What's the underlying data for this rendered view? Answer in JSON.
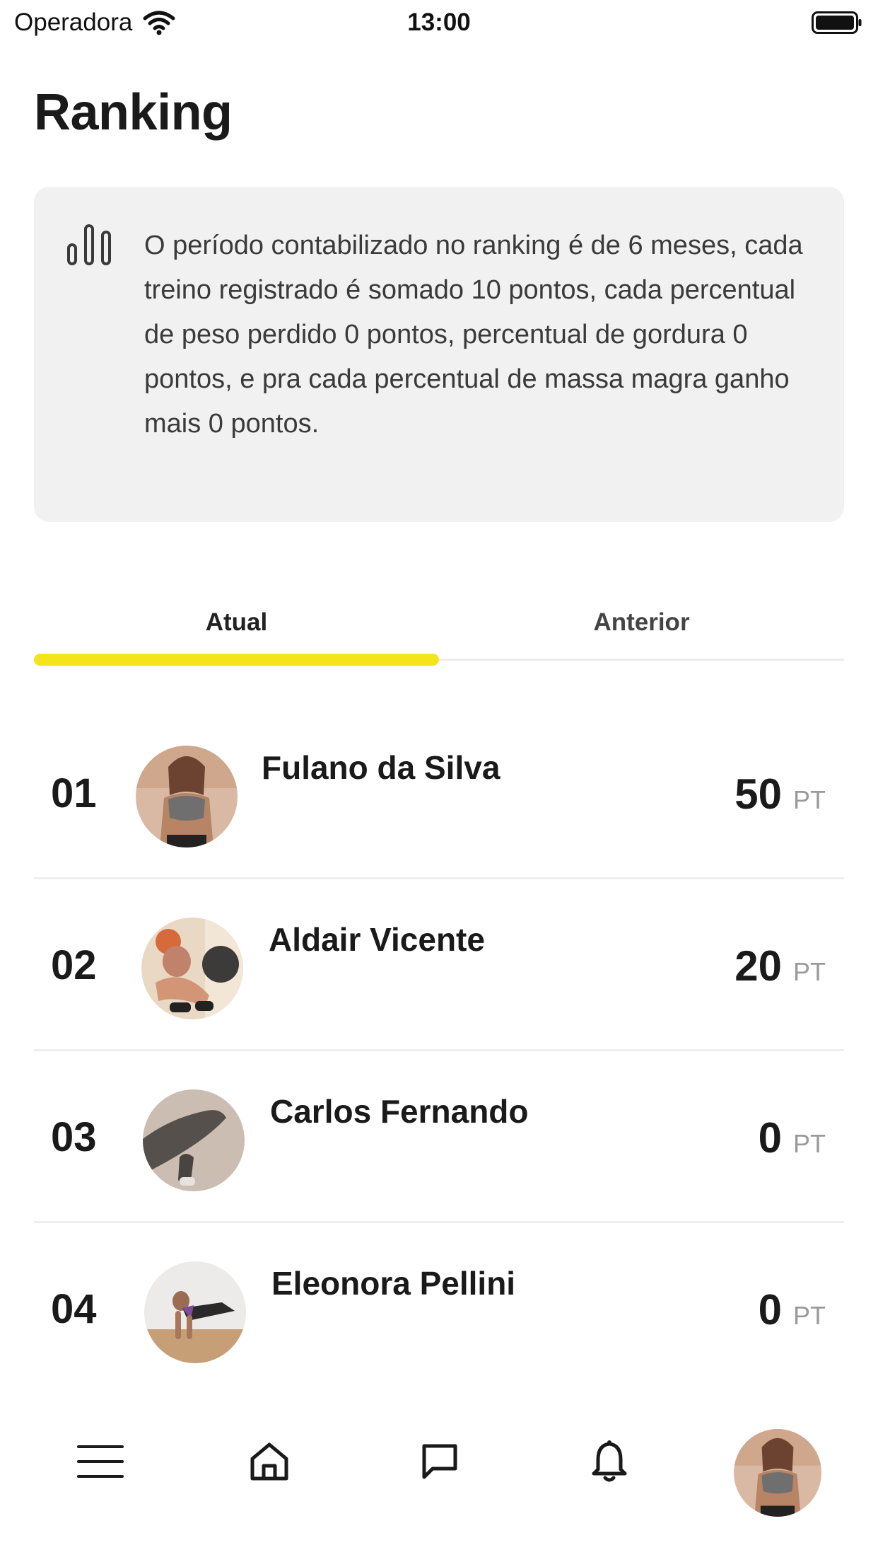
{
  "status_bar": {
    "carrier": "Operadora",
    "time": "13:00"
  },
  "page": {
    "title": "Ranking"
  },
  "info_card": {
    "icon": "bar-chart-icon",
    "text": "O período contabilizado no ranking é de 6 meses, cada treino registrado é somado 10 pontos, cada percentual de peso perdido 0 pontos, percentual de gordura 0 pontos, e pra cada percentual de massa magra ganho mais 0 pontos."
  },
  "tabs": [
    {
      "label": "Atual",
      "active": true
    },
    {
      "label": "Anterior",
      "active": false
    }
  ],
  "ranking": [
    {
      "position": "01",
      "name": "Fulano da Silva",
      "score": "50",
      "unit": "PT"
    },
    {
      "position": "02",
      "name": "Aldair Vicente",
      "score": "20",
      "unit": "PT"
    },
    {
      "position": "03",
      "name": "Carlos Fernando",
      "score": "0",
      "unit": "PT"
    },
    {
      "position": "04",
      "name": "Eleonora Pellini",
      "score": "0",
      "unit": "PT"
    }
  ],
  "bottom_nav": {
    "items": [
      "menu-icon",
      "home-icon",
      "chat-icon",
      "bell-icon",
      "profile-avatar"
    ]
  },
  "colors": {
    "accent": "#f4e41c",
    "card_bg": "#f1f1f1",
    "text": "#1a1a1a",
    "muted": "#9a9a9a"
  }
}
